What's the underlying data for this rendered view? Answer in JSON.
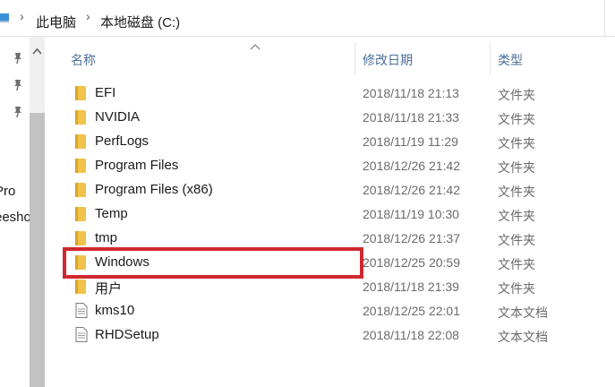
{
  "address_bar": {
    "crumbs": [
      "此电脑",
      "本地磁盘 (C:)"
    ]
  },
  "nav_pane": {
    "partial_items": [
      "Pro",
      "eesho"
    ]
  },
  "columns": {
    "name": "名称",
    "modified": "修改日期",
    "type": "类型"
  },
  "files": [
    {
      "name": "EFI",
      "modified": "2018/11/18 21:13",
      "type": "文件夹",
      "icon": "folder-icon"
    },
    {
      "name": "NVIDIA",
      "modified": "2018/11/18 21:33",
      "type": "文件夹",
      "icon": "folder-icon"
    },
    {
      "name": "PerfLogs",
      "modified": "2018/11/19 11:29",
      "type": "文件夹",
      "icon": "folder-icon"
    },
    {
      "name": "Program Files",
      "modified": "2018/12/26 21:42",
      "type": "文件夹",
      "icon": "folder-icon"
    },
    {
      "name": "Program Files (x86)",
      "modified": "2018/12/26 21:42",
      "type": "文件夹",
      "icon": "folder-icon"
    },
    {
      "name": "Temp",
      "modified": "2018/11/19 10:30",
      "type": "文件夹",
      "icon": "folder-icon"
    },
    {
      "name": "tmp",
      "modified": "2018/12/26 21:37",
      "type": "文件夹",
      "icon": "folder-icon"
    },
    {
      "name": "Windows",
      "modified": "2018/12/25 20:59",
      "type": "文件夹",
      "icon": "folder-icon",
      "highlighted": true
    },
    {
      "name": "用户",
      "modified": "2018/11/18 21:39",
      "type": "文件夹",
      "icon": "folder-icon"
    },
    {
      "name": "kms10",
      "modified": "2018/12/25 22:01",
      "type": "文本文档",
      "icon": "text-document-icon"
    },
    {
      "name": "RHDSetup",
      "modified": "2018/11/18 22:08",
      "type": "文本文档",
      "icon": "text-document-icon"
    }
  ],
  "colors": {
    "folder": "#f2c34b",
    "highlight": "#d0282e",
    "header_text": "#4d6f9a"
  }
}
